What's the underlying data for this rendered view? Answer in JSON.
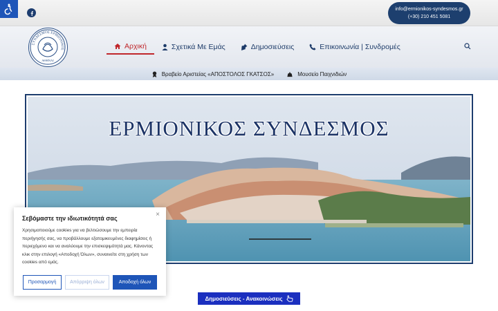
{
  "topbar": {
    "contact_email": "info@ermionikos-syndesmos.gr",
    "contact_phone": "(+30) 210 451 5081"
  },
  "logo": {
    "ring_text": "ΣΥΝΔΕΣΜΟΣ ΕΡΜΙΟΝΙΚΟΣ",
    "city_text": "ΑΘΗΝΑΙ"
  },
  "nav": {
    "items": [
      {
        "label": "Αρχική",
        "icon": "home-icon"
      },
      {
        "label": "Σχετικά Με Εμάς",
        "icon": "user-icon"
      },
      {
        "label": "Δημοσιεύσεις",
        "icon": "pin-icon"
      },
      {
        "label": "Επικοινωνία | Συνδρομές",
        "icon": "phone-icon"
      }
    ]
  },
  "subnav": {
    "items": [
      {
        "label": "Βραβείο Αριστείας «ΑΠΟΣΤΟΛΟΣ ΓΚΑΤΣΟΣ»",
        "icon": "award-icon"
      },
      {
        "label": "Μουσείο Παιχνιδιών",
        "icon": "toy-icon"
      }
    ]
  },
  "hero": {
    "title": "ΕΡΜΙΟΝΙΚΟΣ ΣΥΝΔΕΣΜΟΣ"
  },
  "cookie": {
    "title": "Σεβόμαστε την ιδιωτικότητά σας",
    "text": "Χρησιμοποιούμε cookies για να βελτιώσουμε την εμπειρία περιήγησής σας, να προβάλλουμε εξατομικευμένες διαφημίσεις ή περιεχόμενο και να αναλύουμε την επισκεψιμότητά μας. Κάνοντας κλικ στην επιλογή «Αποδοχή Όλων», συναινείτε στη χρήση των cookies από εμάς.",
    "customize_label": "Προσαρμογή",
    "reject_label": "Απόρριψη όλων",
    "accept_label": "Αποδοχή όλων",
    "close_label": "×"
  },
  "posts_button": {
    "label": "Δημοσιεύσεις - Ανακοινώσεις"
  },
  "colors": {
    "brand_navy": "#1d3f6e",
    "active_red": "#c0262a",
    "button_blue": "#1e55b8"
  }
}
